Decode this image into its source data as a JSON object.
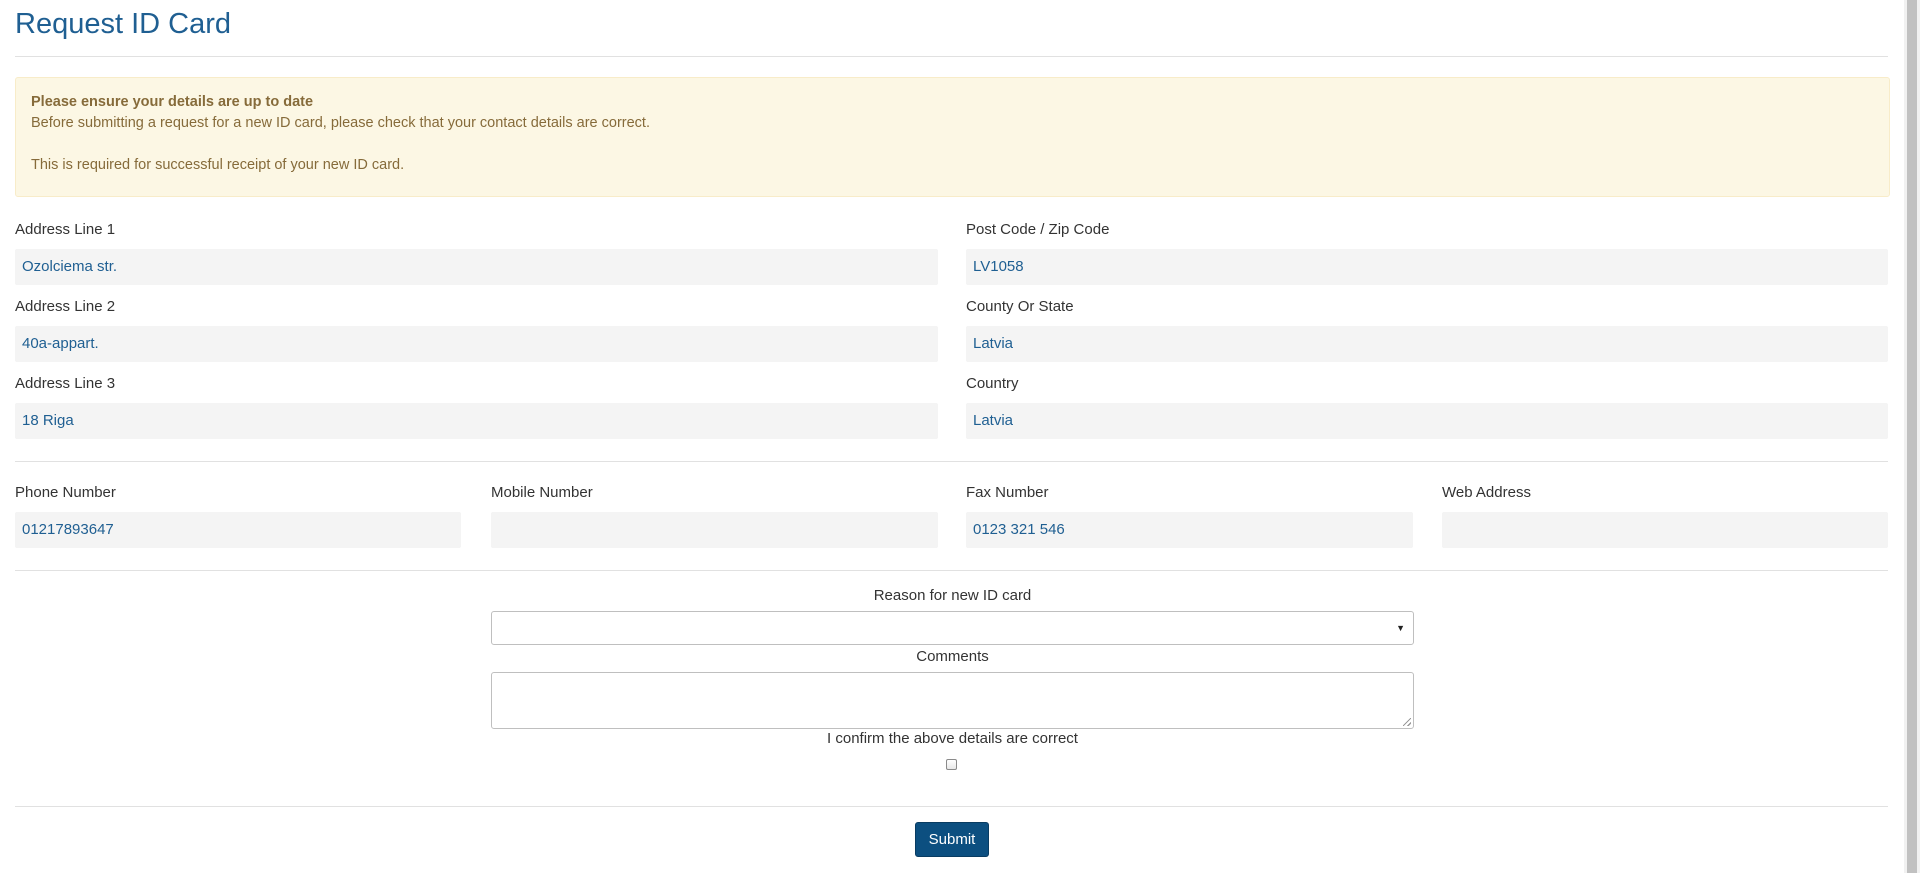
{
  "page_title": "Request ID Card",
  "alert": {
    "heading": "Please ensure your details are up to date",
    "line1": "Before submitting a request for a new ID card, please check that your contact details are correct.",
    "line2": "This is required for successful receipt of your new ID card."
  },
  "address": {
    "line1": {
      "label": "Address Line 1",
      "value": "Ozolciema str."
    },
    "line2": {
      "label": "Address Line 2",
      "value": "40a-appart."
    },
    "line3": {
      "label": "Address Line 3",
      "value": "18 Riga"
    },
    "postcode": {
      "label": "Post Code / Zip Code",
      "value": "LV1058"
    },
    "county": {
      "label": "County Or State",
      "value": "Latvia"
    },
    "country": {
      "label": "Country",
      "value": "Latvia"
    }
  },
  "contact": {
    "phone": {
      "label": "Phone Number",
      "value": "01217893647"
    },
    "mobile": {
      "label": "Mobile Number",
      "value": ""
    },
    "fax": {
      "label": "Fax Number",
      "value": "0123 321 546"
    },
    "web": {
      "label": "Web Address",
      "value": ""
    }
  },
  "request": {
    "reason_label": "Reason for new ID card",
    "reason_value": "",
    "comments_label": "Comments",
    "comments_value": "",
    "confirm_label": "I confirm the above details are correct",
    "confirm_checked": false
  },
  "submit_label": "Submit",
  "colors": {
    "title": "#1f5f92",
    "value_text": "#1f5f92",
    "alert_bg": "#fcf7e4",
    "alert_text": "#866b3a",
    "submit_bg": "#0c4f80"
  },
  "icons": {
    "select_arrow": "caret-down-icon"
  }
}
